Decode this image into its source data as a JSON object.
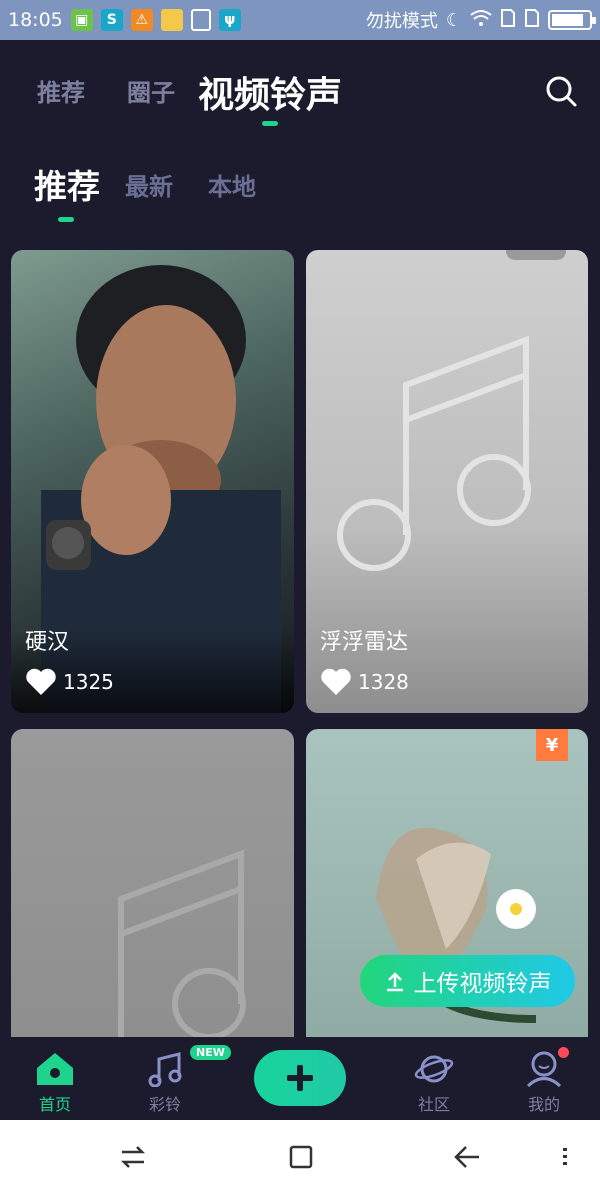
{
  "status_bar": {
    "time": "18:05",
    "dnd_label": "勿扰模式",
    "battery_level": 0.85
  },
  "top_tabs": {
    "items": [
      "推荐",
      "圈子",
      "视频铃声"
    ],
    "active": "视频铃声"
  },
  "sub_tabs": {
    "items": [
      "推荐",
      "最新",
      "本地"
    ],
    "active": "推荐"
  },
  "cards": [
    {
      "title": "硬汉",
      "likes": "1325"
    },
    {
      "title": "浮浮雷达",
      "likes": "1328"
    },
    {
      "title": "",
      "likes": ""
    },
    {
      "title": "",
      "likes": "",
      "price_badge": "¥"
    }
  ],
  "upload_button": {
    "label": "上传视频铃声"
  },
  "bottom_nav": {
    "items": [
      {
        "label": "首页",
        "icon": "home-icon",
        "active": true
      },
      {
        "label": "彩铃",
        "icon": "music-note-icon",
        "badge": "NEW"
      },
      {
        "label": "",
        "icon": "plus-icon"
      },
      {
        "label": "社区",
        "icon": "planet-icon"
      },
      {
        "label": "我的",
        "icon": "user-icon",
        "dot": true
      }
    ]
  },
  "colors": {
    "accent": "#1ed38b",
    "background": "#1b1b2d",
    "status_bar": "#7d95bf",
    "muted": "#7d7f9f",
    "badge_orange": "#ff7a3d"
  }
}
